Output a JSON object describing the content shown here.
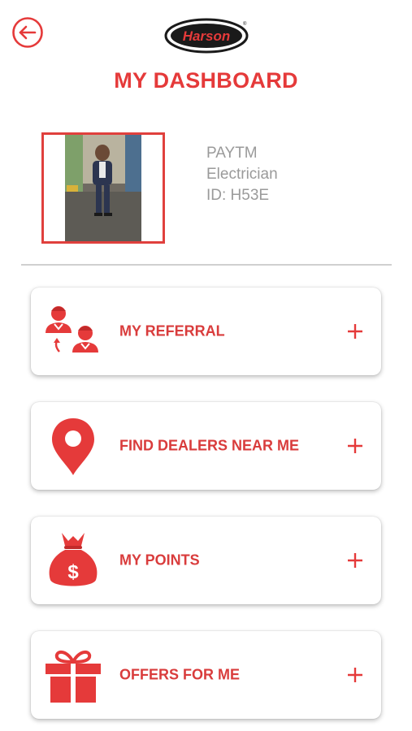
{
  "header": {
    "back_icon": "arrow-left-icon",
    "logo_text": "Harson",
    "title": "MY DASHBOARD"
  },
  "profile": {
    "name": "PAYTM",
    "role": "Electrician",
    "id_text": "ID: H53E"
  },
  "menu": {
    "items": [
      {
        "label": "MY REFERRAL",
        "icon": "referral-users-icon"
      },
      {
        "label": "FIND DEALERS NEAR ME",
        "icon": "location-pin-icon"
      },
      {
        "label": "MY POINTS",
        "icon": "money-bag-icon"
      },
      {
        "label": "OFFERS FOR ME",
        "icon": "gift-icon"
      }
    ],
    "expand_icon": "plus-icon"
  },
  "colors": {
    "accent": "#e53a3a",
    "text_muted": "#9a9a9a",
    "divider": "#d0d0d0"
  }
}
